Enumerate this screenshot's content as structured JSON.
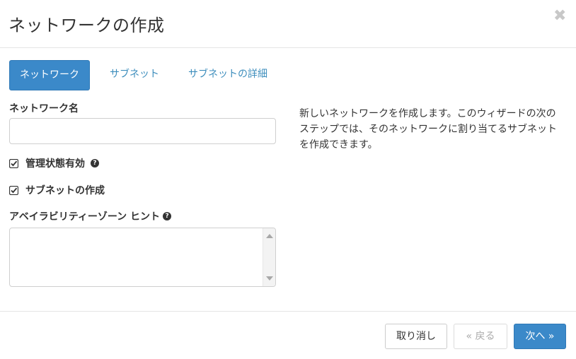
{
  "dialog": {
    "title": "ネットワークの作成",
    "close_glyph": "✖"
  },
  "tabs": [
    {
      "label": "ネットワーク",
      "active": true
    },
    {
      "label": "サブネット",
      "active": false
    },
    {
      "label": "サブネットの詳細",
      "active": false
    }
  ],
  "form": {
    "network_name_label": "ネットワーク名",
    "network_name_value": "",
    "admin_state_label": "管理状態有効",
    "admin_state_checked": true,
    "create_subnet_label": "サブネットの作成",
    "create_subnet_checked": true,
    "az_hint_label": "アベイラビリティーゾーン ヒント",
    "help_glyph": "?"
  },
  "description": "新しいネットワークを作成します。このウィザードの次のステップでは、そのネットワークに割り当てるサブネットを作成できます。",
  "footer": {
    "cancel_label": "取り消し",
    "back_label": "« 戻る",
    "next_label": "次へ »"
  },
  "colors": {
    "primary": "#3b89c9",
    "link": "#3c8dbc"
  }
}
